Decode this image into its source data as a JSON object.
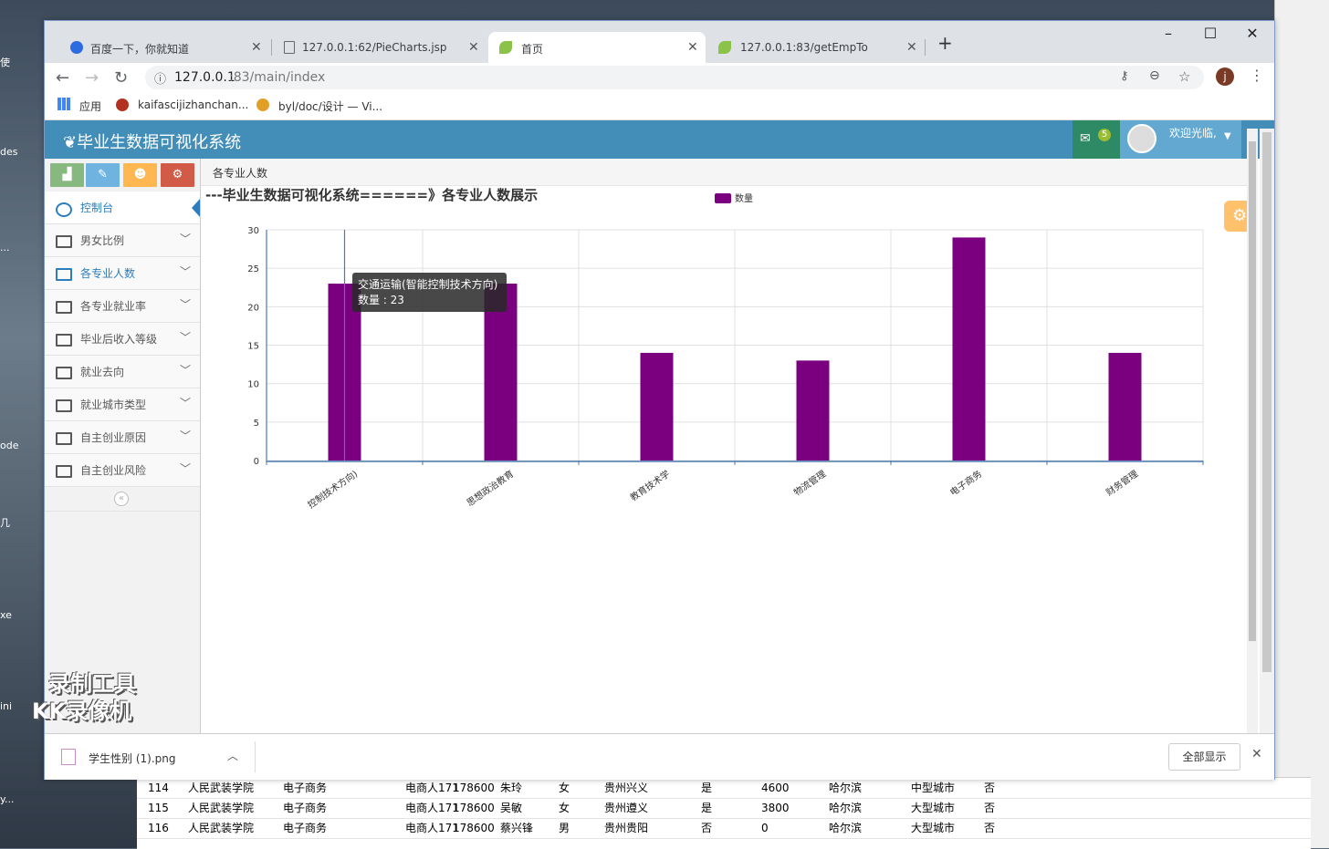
{
  "desktop": {
    "left_labels": [
      "使",
      "des",
      "...",
      "ode",
      "几",
      "xe",
      "ini",
      "y..."
    ]
  },
  "browser": {
    "tabs": [
      {
        "title": "百度一下，你就知道",
        "active": false
      },
      {
        "title": "127.0.0.1:62/PieCharts.jsp",
        "active": false
      },
      {
        "title": "首页",
        "active": true
      },
      {
        "title": "127.0.0.1:83/getEmpTo",
        "active": false
      }
    ],
    "url_host": "127.0.0.1",
    "url_path": ":83/main/index",
    "bookmarks": [
      "应用",
      "kaifascijizhanchan...",
      "byl/doc/设计 — Vi..."
    ]
  },
  "app": {
    "title": "毕业生数据可视化系统",
    "mail_count": "5",
    "welcome": "欢迎光临,",
    "breadcrumb": "各专业人数",
    "sidebar": [
      {
        "label": "控制台",
        "active": true
      },
      {
        "label": "男女比例"
      },
      {
        "label": "各专业人数",
        "highlight": true
      },
      {
        "label": "各专业就业率"
      },
      {
        "label": "毕业后收入等级"
      },
      {
        "label": "就业去向"
      },
      {
        "label": "就业城市类型"
      },
      {
        "label": "自主创业原因"
      },
      {
        "label": "自主创业风险"
      }
    ]
  },
  "chart_data": {
    "type": "bar",
    "title": "---毕业生数据可视化系统======》各专业人数展示",
    "legend": "数量",
    "legend_position": "top",
    "bar_color": "#7b0080",
    "categories": [
      "交通运输(智能控制技术方向)",
      "思想政治教育",
      "教育技术学",
      "物流管理",
      "电子商务",
      "财务管理"
    ],
    "category_labels": [
      "控制技术方向)",
      "思想政治教育",
      "教育技术学",
      "物流管理",
      "电子商务",
      "财务管理"
    ],
    "values": [
      23,
      23,
      14,
      13,
      29,
      14
    ],
    "ylim": [
      0,
      30
    ],
    "yticks": [
      0,
      5,
      10,
      15,
      20,
      25,
      30
    ],
    "grid": true,
    "tooltip": {
      "title": "交通运输(智能控制技术方向)",
      "line": "数量 : 23"
    }
  },
  "download_bar": {
    "file": "学生性别 (1).png",
    "show_all": "全部显示"
  },
  "excel": {
    "rows": [
      [
        "114",
        "人民武装学院",
        "电子商务",
        "电商人171",
        "178600",
        "朱玲",
        "女",
        "贵州兴义",
        "是",
        "4600",
        "哈尔滨",
        "中型城市",
        "否"
      ],
      [
        "115",
        "人民武装学院",
        "电子商务",
        "电商人171",
        "178600",
        "吴敏",
        "女",
        "贵州遵义",
        "是",
        "3800",
        "哈尔滨",
        "大型城市",
        "否"
      ],
      [
        "116",
        "人民武装学院",
        "电子商务",
        "电商人171",
        "178600",
        "蔡兴锋",
        "男",
        "贵州贵阳",
        "否",
        "0",
        "哈尔滨",
        "大型城市",
        "否"
      ]
    ]
  },
  "watermark": [
    "录制工具",
    "KK录像机"
  ]
}
